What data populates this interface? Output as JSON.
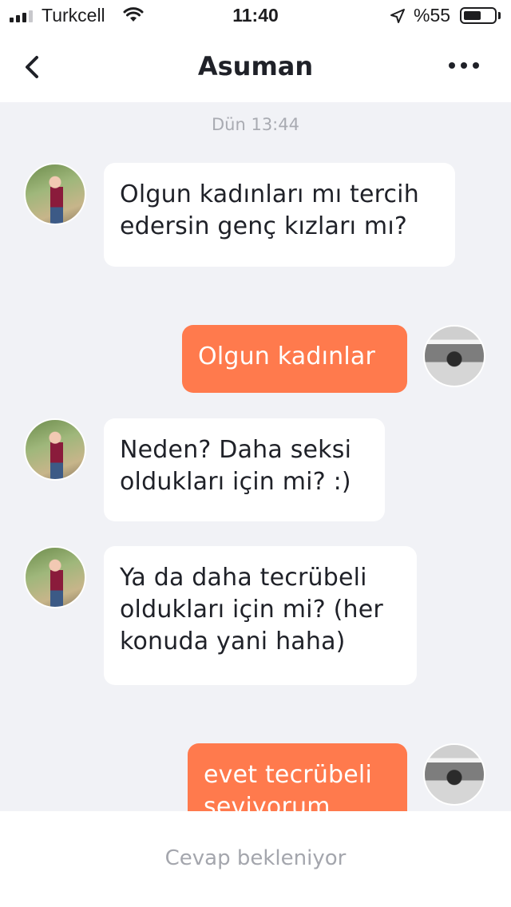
{
  "status_bar": {
    "carrier": "Turkcell",
    "time": "11:40",
    "battery_text": "%55",
    "battery_level": 0.55
  },
  "header": {
    "title": "Asuman",
    "back_icon": "chevron-left-icon",
    "more_icon": "more-horizontal-icon"
  },
  "chat": {
    "timestamp": "Dün 13:44",
    "messages": [
      {
        "from": "her",
        "text": "Olgun kadınları mı tercih edersin genç kızları mı?"
      },
      {
        "from": "me",
        "text": "Olgun kadınlar"
      },
      {
        "from": "her",
        "text": "Neden? Daha seksi oldukları için mi? :)"
      },
      {
        "from": "her",
        "text": "Ya da daha tecrübeli oldukları için mi? (her konuda yani haha)"
      },
      {
        "from": "me",
        "text": "evet  tecrübeli seviyorum"
      }
    ]
  },
  "footer": {
    "status": "Cevap bekleniyor"
  },
  "colors": {
    "accent": "#ff7a4d",
    "background": "#f1f2f6",
    "incoming_bubble": "#ffffff"
  }
}
